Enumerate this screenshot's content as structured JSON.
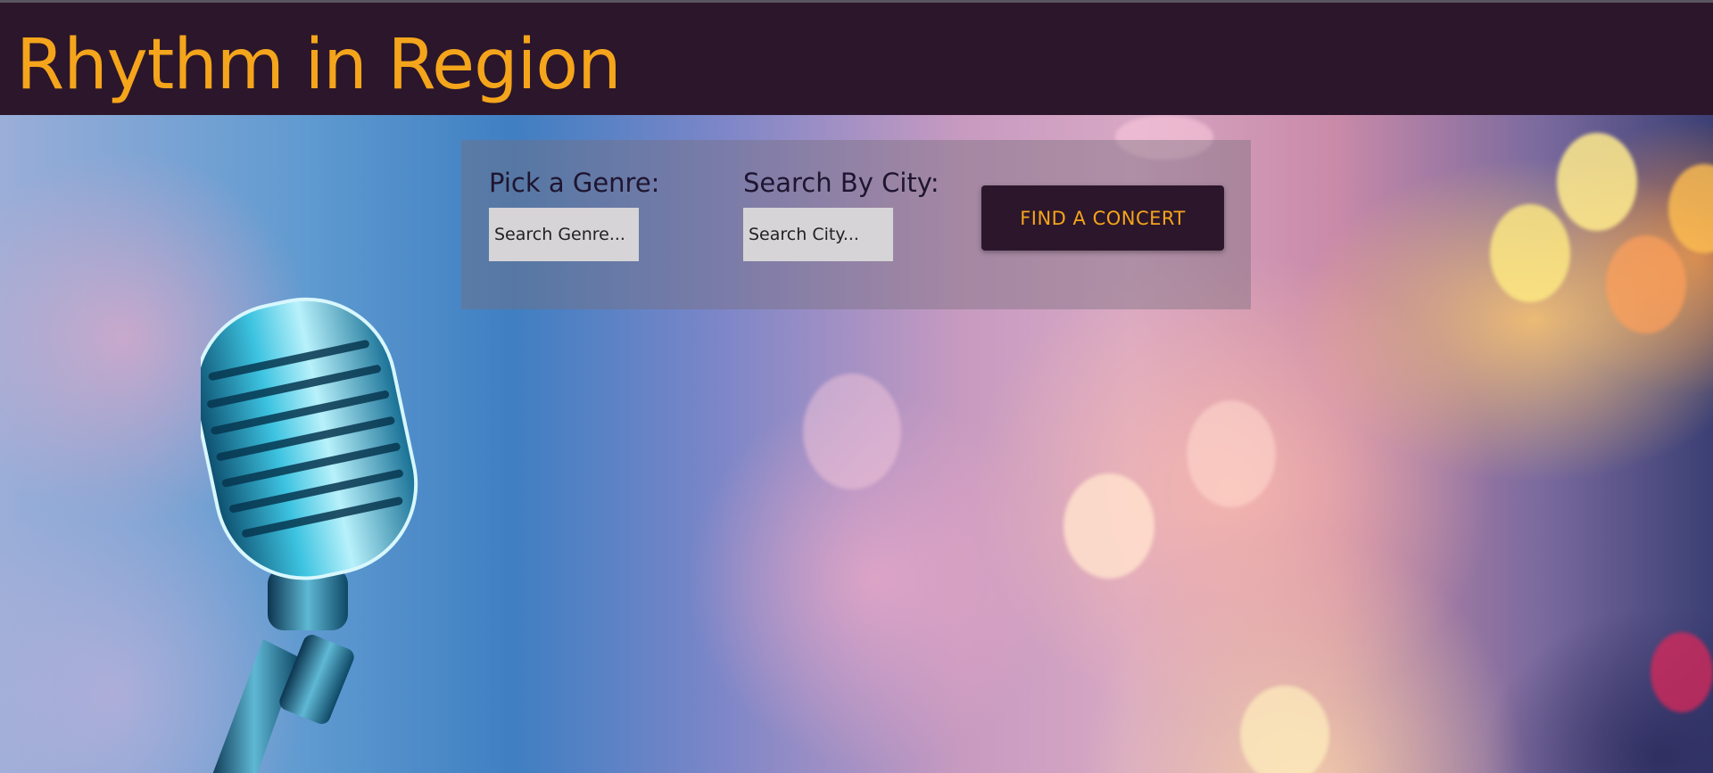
{
  "header": {
    "site_title": "Rhythm in Region"
  },
  "search": {
    "genre_label": "Pick a Genre:",
    "genre_placeholder": "Search Genre...",
    "city_label": "Search By City:",
    "city_placeholder": "Search City...",
    "submit_label": "FIND A CONCERT"
  },
  "hero": {
    "image": "microphone-bokeh-background",
    "icon": "microphone-icon"
  },
  "colors": {
    "header_bg": "#2c162b",
    "accent": "#f5a51b",
    "input_bg": "#d6d4d6"
  }
}
